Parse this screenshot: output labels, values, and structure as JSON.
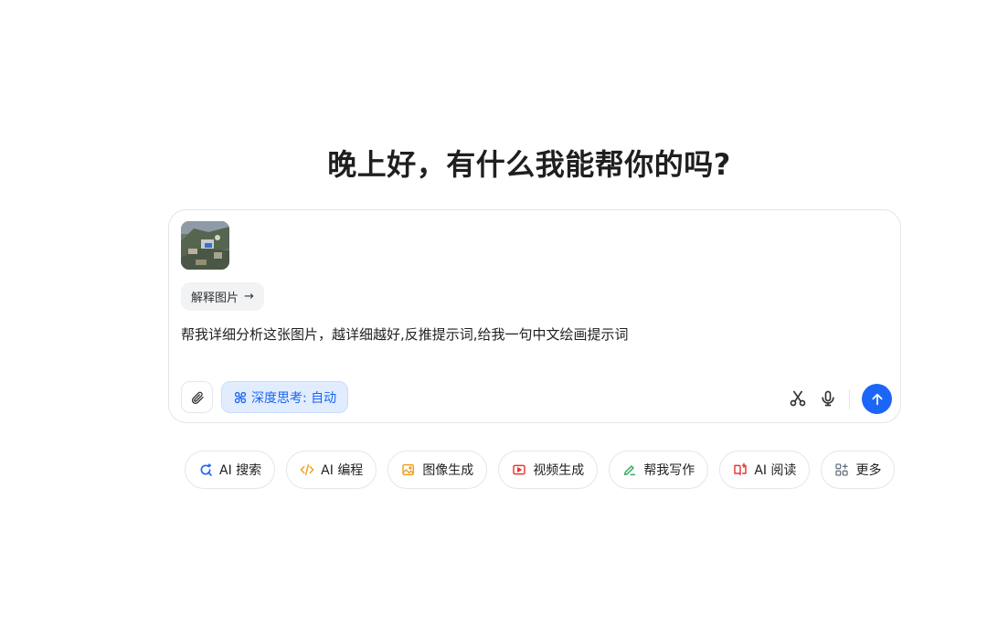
{
  "greeting": "晚上好，有什么我能帮你的吗?",
  "composer": {
    "attachment_icon": "image-thumbnail",
    "explain_chip_label": "解释图片",
    "explain_chip_arrow": "→",
    "input_text": "帮我详细分析这张图片，越详细越好,反推提示词,给我一句中文绘画提示词",
    "deep_think_label": "深度思考: 自动",
    "accent_color": "#1b66f6"
  },
  "shortcuts": [
    {
      "label": "AI 搜索",
      "icon": "search-icon",
      "color": "#1b66f6"
    },
    {
      "label": "AI 编程",
      "icon": "code-icon",
      "color": "#f0a020"
    },
    {
      "label": "图像生成",
      "icon": "image-icon",
      "color": "#f0a020"
    },
    {
      "label": "视频生成",
      "icon": "video-icon",
      "color": "#e53935"
    },
    {
      "label": "帮我写作",
      "icon": "pen-icon",
      "color": "#2eaa5c"
    },
    {
      "label": "AI 阅读",
      "icon": "book-icon",
      "color": "#e53935"
    },
    {
      "label": "更多",
      "icon": "grid-icon",
      "color": "#6b7585"
    }
  ]
}
